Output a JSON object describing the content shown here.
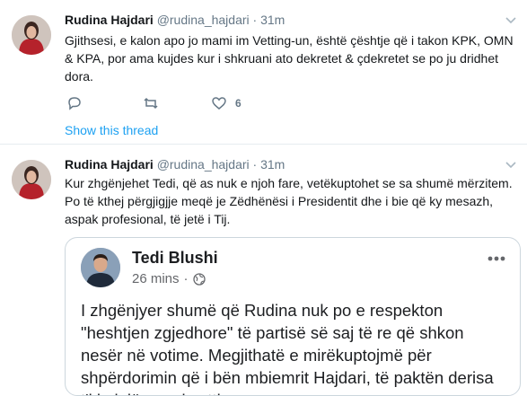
{
  "tweets": [
    {
      "name": "Rudina Hajdari",
      "handle": "@rudina_hajdari",
      "separator": "·",
      "time": "31m",
      "text": "Gjithsesi, e kalon apo jo mami im Vetting-un, është çështje që i takon KPK, OMN & KPA, por ama kujdes kur i shkruani ato dekretet & çdekretet se po ju dridhet dora.",
      "actions": {
        "reply_icon": "reply-icon",
        "retweet_icon": "retweet-icon",
        "like_icon": "heart-icon",
        "like_count": "6"
      },
      "show_thread": "Show this thread"
    },
    {
      "name": "Rudina Hajdari",
      "handle": "@rudina_hajdari",
      "separator": "·",
      "time": "31m",
      "text": "Kur zhgënjehet Tedi, që as nuk e njoh fare, vetëkuptohet se sa shumë mërzitem. Po të kthej përgjigjje meqë je Zëdhënësi i Presidentit dhe i bie që ky mesazh, aspak profesional, të jetë i Tij.",
      "embedded": {
        "name": "Tedi Blushi",
        "time": "26 mins",
        "separator": "·",
        "privacy_icon": "globe-icon",
        "more_icon": "more-horizontal-icon",
        "text": "I zhgënjyer shumë që Rudina nuk po e respekton \"heshtjen zgjedhore\" të partisë së saj të re që shkon nesër në votime. Megjithatë e mirëkuptojmë për shpërdorimin që i bën mbiemrit Hajdari, të paktën derisa t'i kalojë mami vettingun."
      }
    }
  ],
  "colors": {
    "link": "#1da1f2",
    "muted": "#657786",
    "border": "#e6ecf0"
  }
}
